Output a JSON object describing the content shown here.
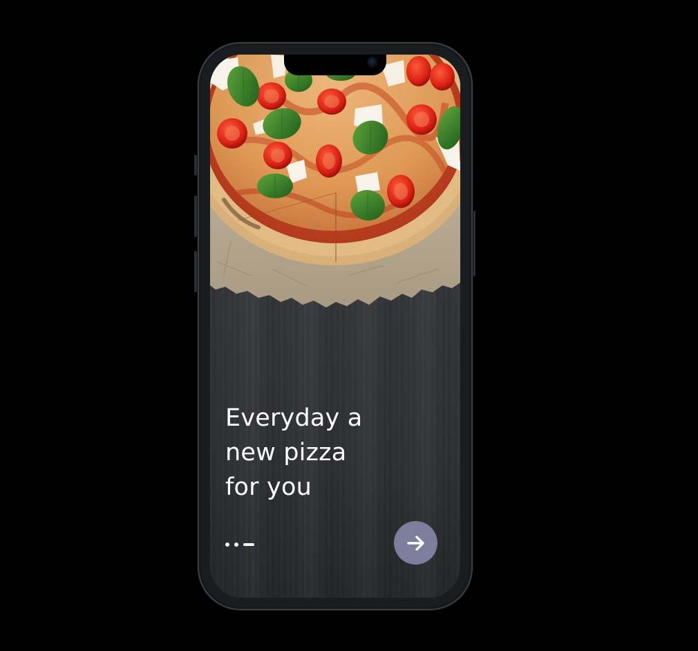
{
  "onboarding": {
    "headline": {
      "line1": "Everyday a",
      "line2": "new pizza",
      "line3": "for you"
    },
    "pager": {
      "total": 3,
      "active_index": 3
    },
    "next_button": {
      "icon": "arrow-right-icon",
      "color": "#7c7e9b"
    }
  },
  "hero_image": {
    "subject": "pizza-with-basil-tomatoes-mozzarella"
  },
  "colors": {
    "background": "#000000",
    "screen": "#2f3134",
    "text": "#ffffff",
    "accent": "#7c7e9b"
  }
}
